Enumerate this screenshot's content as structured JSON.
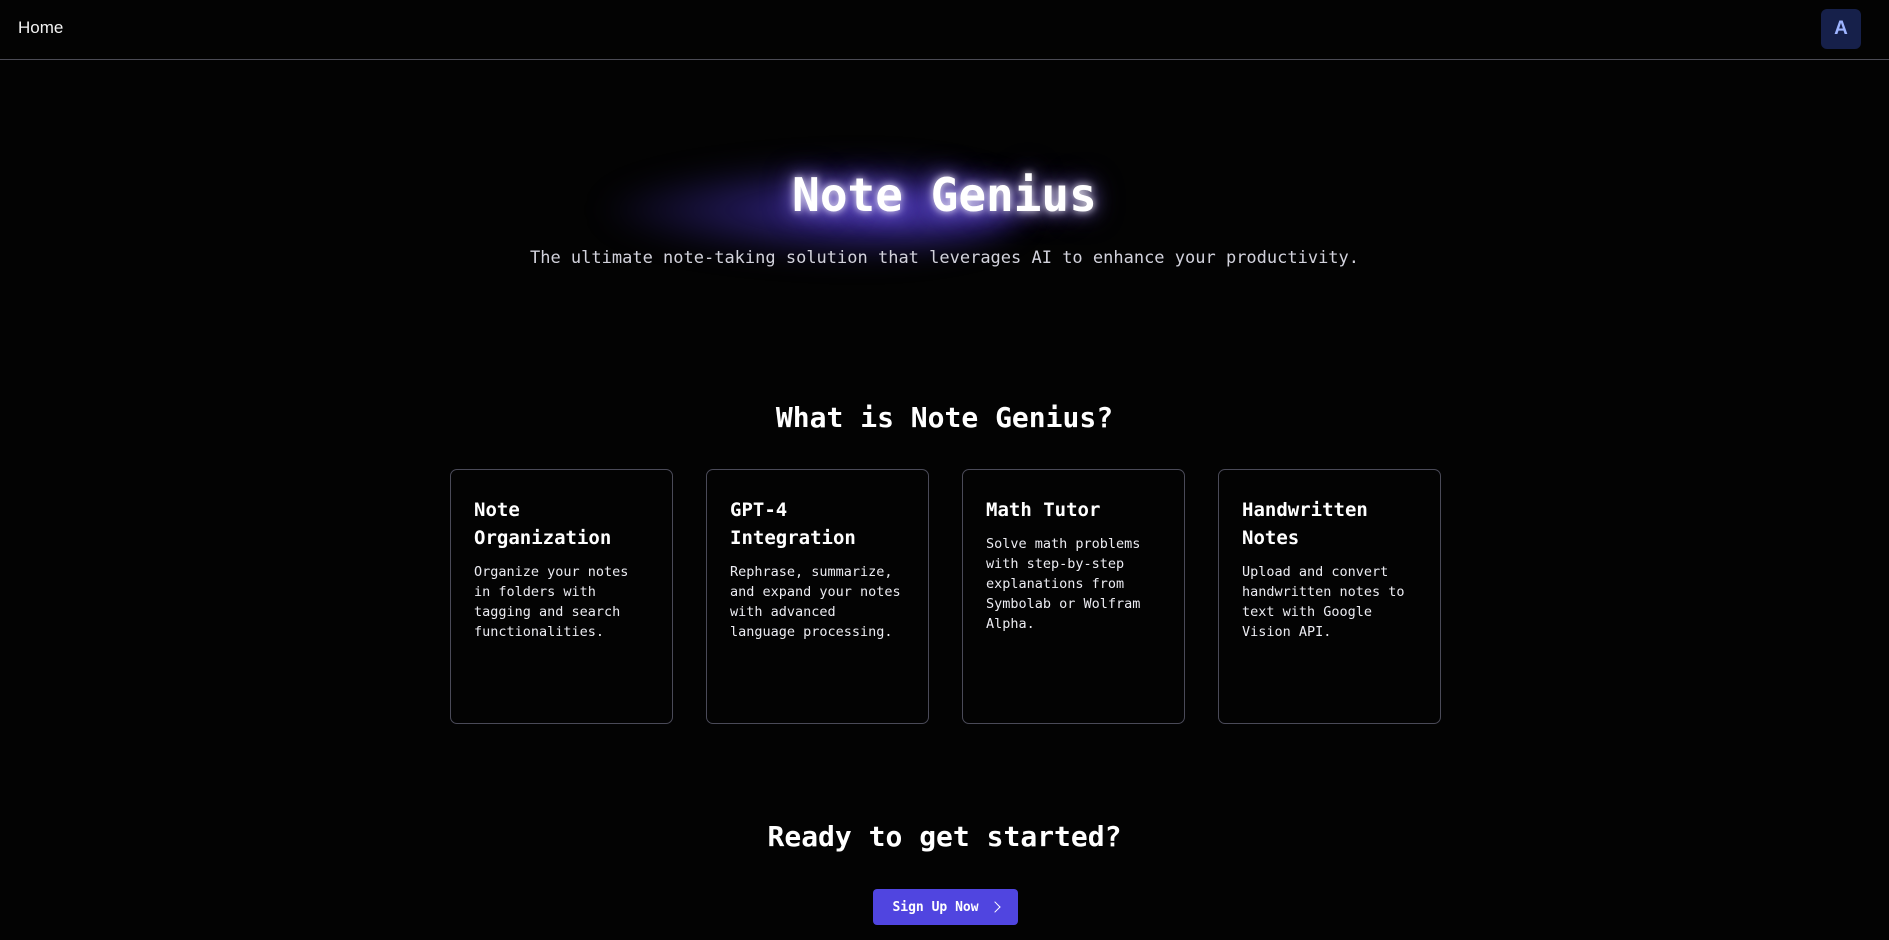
{
  "nav": {
    "home_label": "Home",
    "avatar_initial": "A"
  },
  "hero": {
    "title": "Note Genius",
    "subtitle": "The ultimate note-taking solution that leverages AI to enhance your productivity."
  },
  "features": {
    "heading": "What is Note Genius?",
    "cards": [
      {
        "title": "Note Organization",
        "description": "Organize your notes in folders with tagging and search functionalities."
      },
      {
        "title": "GPT-4 Integration",
        "description": "Rephrase, summarize, and expand your notes with advanced language processing."
      },
      {
        "title": "Math Tutor",
        "description": "Solve math problems with step-by-step explanations from Symbolab or Wolfram Alpha."
      },
      {
        "title": "Handwritten Notes",
        "description": "Upload and convert handwritten notes to text with Google Vision API."
      }
    ]
  },
  "cta": {
    "heading": "Ready to get started?",
    "button_label": "Sign Up Now",
    "button_icon": "chevron-right-icon"
  },
  "colors": {
    "background": "#030303",
    "accent": "#5045e0",
    "avatar_bg": "#16204a",
    "avatar_text": "#9eb4ff",
    "card_border": "#4a4a58"
  }
}
